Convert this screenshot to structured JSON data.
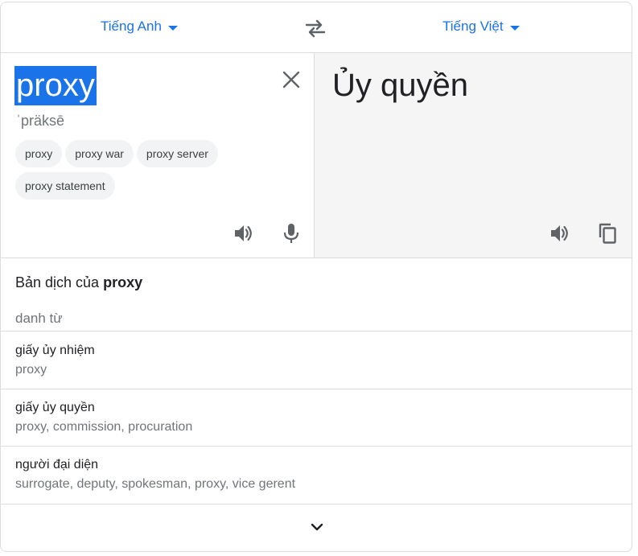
{
  "lang_bar": {
    "source_lang": "Tiếng Anh",
    "target_lang": "Tiếng Việt",
    "swap_icon": "swap-arrows-icon"
  },
  "source": {
    "text": "proxy",
    "phonetic": "ˈpräksē",
    "suggestions": [
      "proxy",
      "proxy war",
      "proxy server",
      "proxy statement"
    ],
    "clear_icon": "close-icon",
    "listen_icon": "speaker-icon",
    "mic_icon": "mic-icon"
  },
  "target": {
    "text": "Ủy quyền",
    "listen_icon": "speaker-icon",
    "copy_icon": "copy-icon"
  },
  "dictionary": {
    "title_prefix": "Bản dịch của",
    "title_word": "proxy",
    "part_of_speech": "danh từ",
    "entries": [
      {
        "word": "giấy ủy nhiệm",
        "synonyms": "proxy"
      },
      {
        "word": "giấy ủy quyền",
        "synonyms": "proxy, commission, procuration"
      },
      {
        "word": "người đại diện",
        "synonyms": "surrogate, deputy, spokesman, proxy, vice gerent"
      }
    ],
    "expand_icon": "chevron-down-icon"
  },
  "colors": {
    "accent": "#1a73e8",
    "muted": "#70757a",
    "target_bg": "#f5f5f5"
  }
}
